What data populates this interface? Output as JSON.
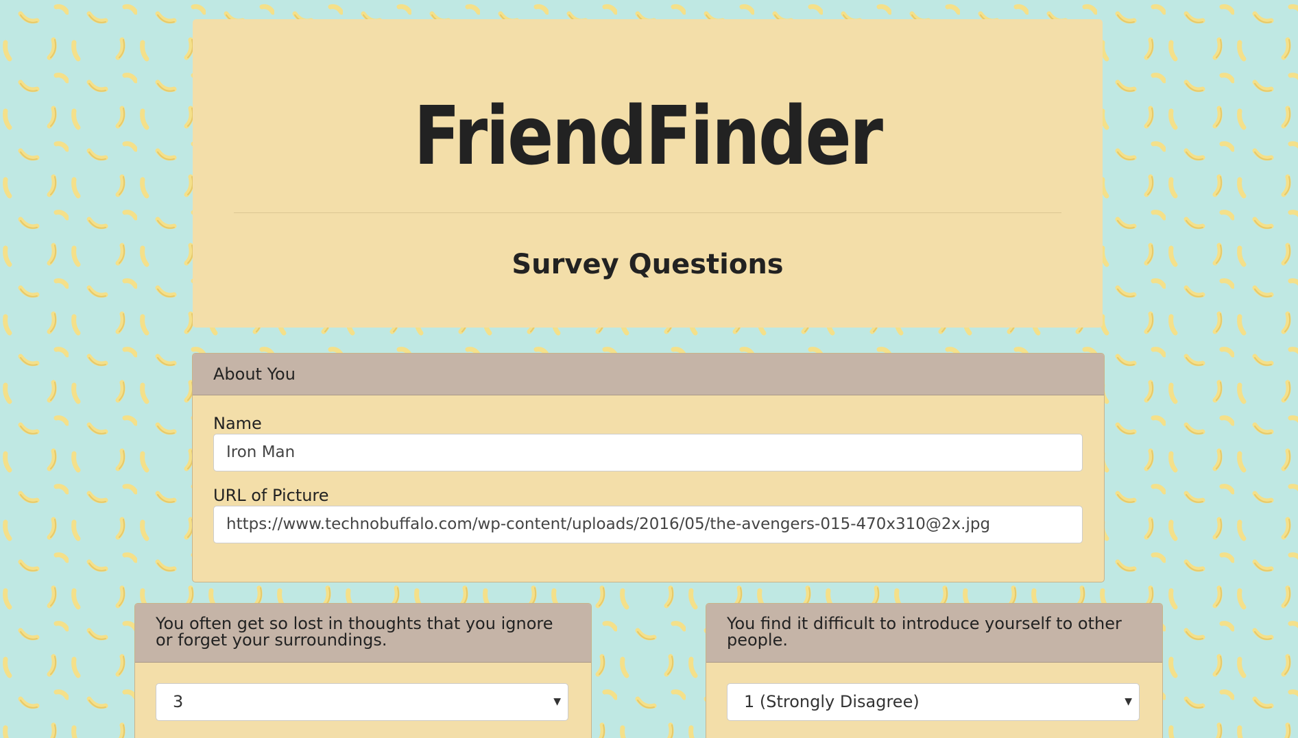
{
  "header": {
    "title": "FriendFinder",
    "subtitle": "Survey Questions"
  },
  "about_panel": {
    "heading": "About You",
    "name_label": "Name",
    "name_value": "Iron Man",
    "picture_label": "URL of Picture",
    "picture_value": "https://www.technobuffalo.com/wp-content/uploads/2016/05/the-avengers-015-470x310@2x.jpg"
  },
  "questions": [
    {
      "text": "You often get so lost in thoughts that you ignore or forget your surroundings.",
      "selected": "3"
    },
    {
      "text": "You find it difficult to introduce yourself to other people.",
      "selected": "1 (Strongly Disagree)"
    }
  ],
  "icons": {
    "select_caret": "caret-down-icon",
    "background": "banana-pattern"
  },
  "colors": {
    "background": "#bfe8e3",
    "banana": "#f4e08a",
    "panel": "#f3dea9",
    "panel_heading": "#c5b4a7"
  }
}
